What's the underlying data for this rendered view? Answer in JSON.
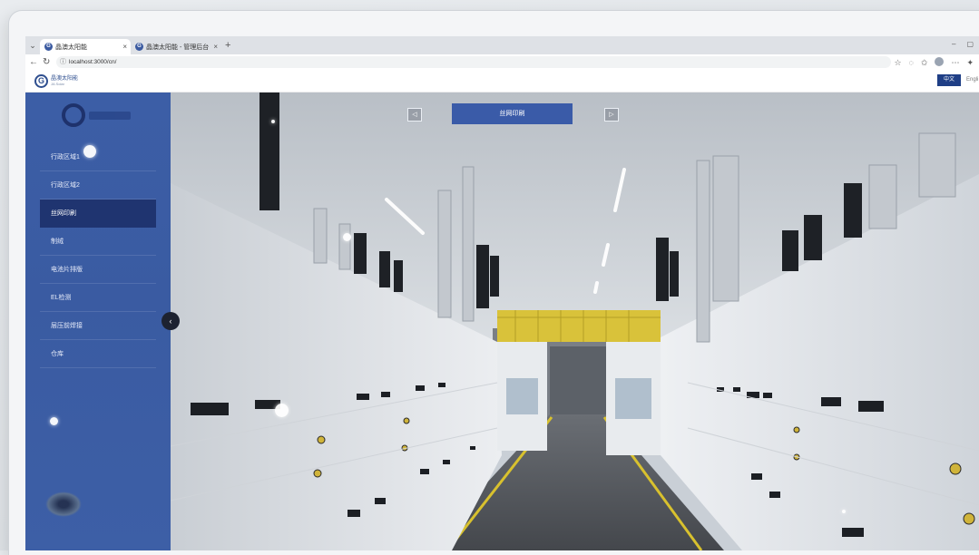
{
  "browser": {
    "tabs": [
      {
        "title": "晶澳太阳能",
        "active": true
      },
      {
        "title": "晶澳太阳能 - 管理后台",
        "active": false
      }
    ],
    "url": "localhost:3000/cn/",
    "new_tab_glyph": "+",
    "tab_close_glyph": "×",
    "dropdown_glyph": "⌄"
  },
  "site": {
    "logo_name": "晶澳太阳能",
    "logo_sub": "JA Solar",
    "lang_zh": "中文",
    "lang_en": "Engli"
  },
  "scene": {
    "title": "丝网印刷",
    "prev_glyph": "◁",
    "next_glyph": "▷"
  },
  "sidebar": {
    "items": [
      {
        "label": "行政区域1"
      },
      {
        "label": "行政区域2"
      },
      {
        "label": "丝网印刷",
        "active": true
      },
      {
        "label": "制绒"
      },
      {
        "label": "电池片排版"
      },
      {
        "label": "EL检测"
      },
      {
        "label": "层压前焊接"
      },
      {
        "label": "仓库"
      }
    ],
    "collapse_glyph": "‹"
  },
  "colors": {
    "accent": "#3a5ba8",
    "active_menu": "#1f3470",
    "sidebar": "#3c5ea6"
  }
}
